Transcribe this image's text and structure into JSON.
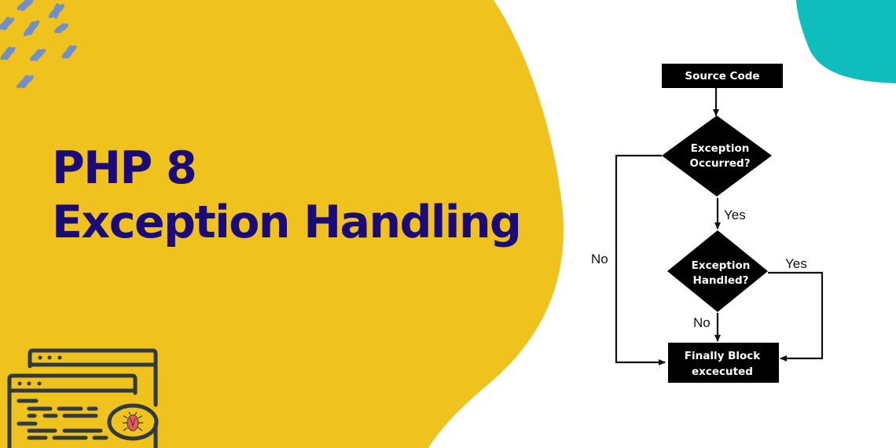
{
  "colors": {
    "yellow": "#f0c21e",
    "teal": "#10bdbd",
    "title": "#1b0a7a",
    "bird": "#6f8fcf",
    "icon_stroke": "#2f3a3c",
    "bug": "#e85a5a",
    "node_fill": "#000000"
  },
  "title": {
    "line1": "PHP 8",
    "line2": "Exception Handling"
  },
  "decor": {
    "top_left": "flock-of-birds-icon",
    "bottom_left": "browser-windows-with-bug-icon",
    "top_right": "teal-blob"
  },
  "flowchart": {
    "nodes": {
      "source": "Source Code",
      "occurred_1": "Exception",
      "occurred_2": "Occurred?",
      "handled_1": "Exception",
      "handled_2": "Handled?",
      "finally_1": "Finally Block",
      "finally_2": "excecuted"
    },
    "edges": {
      "occurred_yes": "Yes",
      "occurred_no": "No",
      "handled_yes": "Yes",
      "handled_no": "No"
    }
  }
}
